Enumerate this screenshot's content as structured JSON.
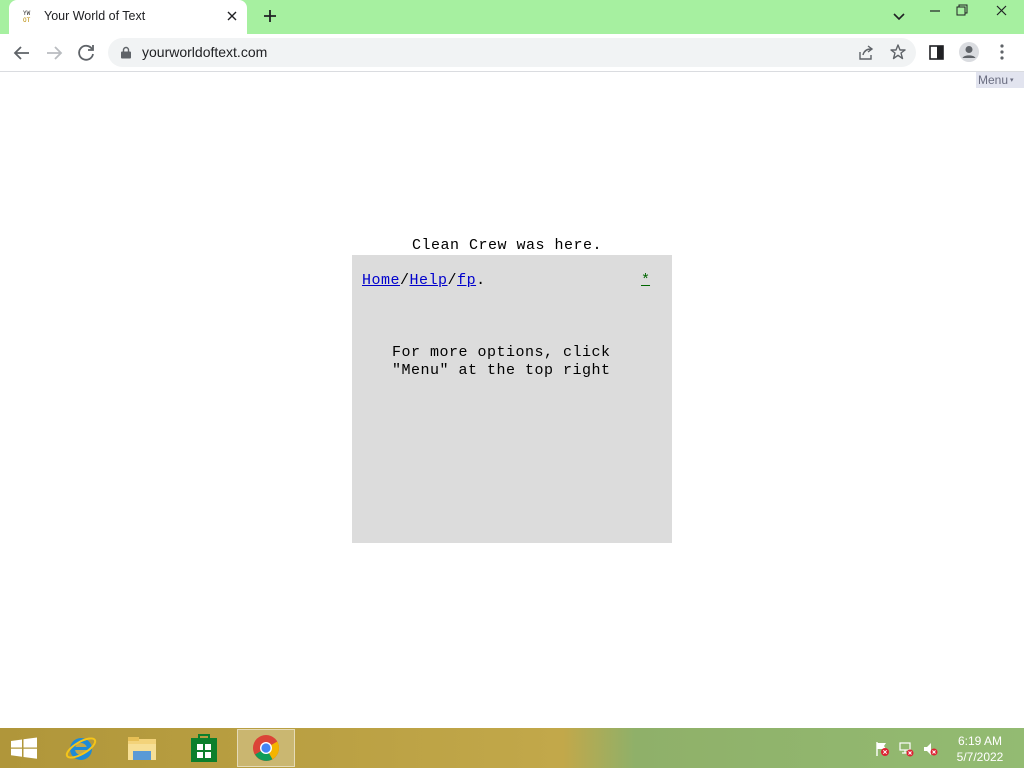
{
  "browser": {
    "tab": {
      "title": "Your World of Text",
      "favicon": [
        "YW",
        "OT"
      ]
    },
    "address": {
      "url": "yourworldoftext.com"
    }
  },
  "page": {
    "menu_label": "Menu",
    "menu_arrow": "▾",
    "crew_message": "Clean Crew was here.",
    "breadcrumb": {
      "home": "Home",
      "sep1": "/",
      "help": "Help",
      "sep2": "/",
      "fp": "fp",
      "end": "."
    },
    "star_link": "*",
    "help_line1": "For more options, click",
    "help_line2": "\"Menu\" at the top right"
  },
  "taskbar": {
    "time": "6:19 AM",
    "date": "5/7/2022"
  },
  "colors": {
    "titlebar": "#a6f0a0",
    "panel": "#dcdcdc",
    "link": "#0000cc",
    "star_link": "#006600"
  }
}
